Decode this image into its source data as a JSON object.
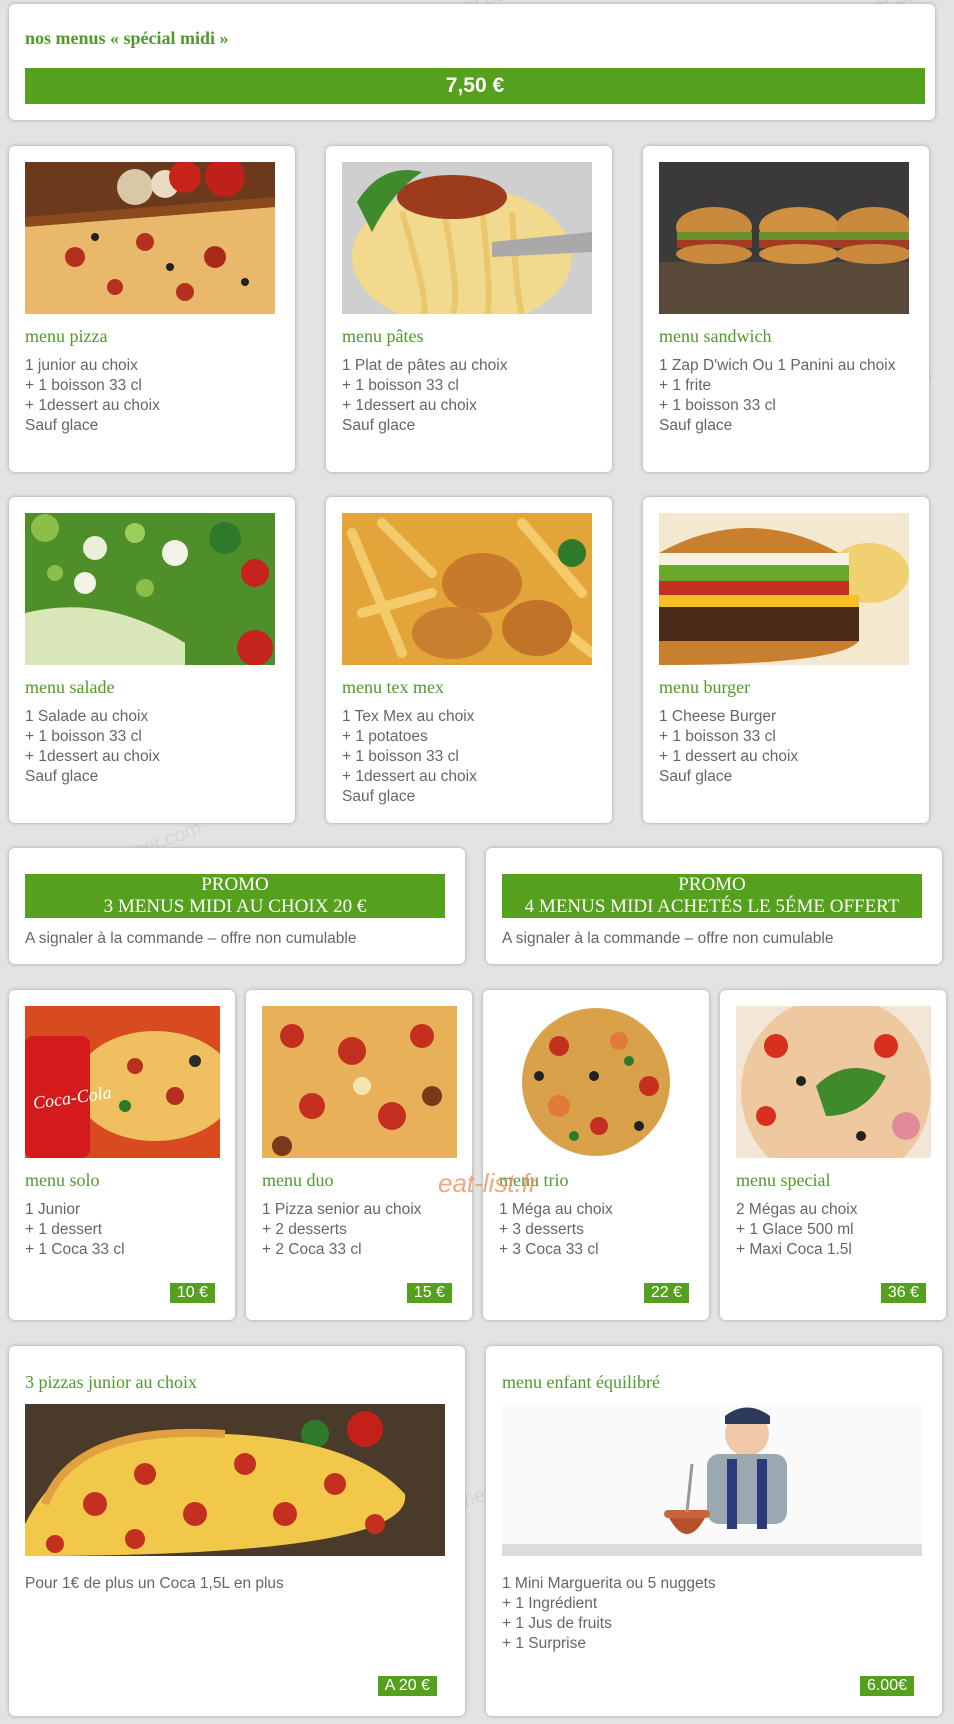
{
  "header": {
    "title": "nos menus « spécial midi »",
    "price": "7,50 €"
  },
  "menus_row1": [
    {
      "title": "menu pizza",
      "lines": [
        "1 junior au choix",
        "+ 1 boisson 33 cl",
        "+ 1dessert au choix",
        "Sauf glace"
      ],
      "image": "pizza-photo"
    },
    {
      "title": "menu pâtes",
      "lines": [
        "1 Plat de pâtes au choix",
        "+ 1 boisson 33 cl",
        "+ 1dessert au choix",
        "Sauf glace"
      ],
      "image": "pasta-photo"
    },
    {
      "title": "menu sandwich",
      "lines": [
        "1 Zap D'wich Ou 1 Panini au choix",
        "+ 1 frite",
        "+ 1 boisson 33 cl",
        "Sauf glace"
      ],
      "image": "sandwich-photo"
    }
  ],
  "menus_row2": [
    {
      "title": "menu salade",
      "lines": [
        "1 Salade au choix",
        "+ 1 boisson 33 cl",
        "+ 1dessert au choix",
        "Sauf glace"
      ],
      "image": "salad-photo"
    },
    {
      "title": "menu tex mex",
      "lines": [
        "1 Tex Mex au choix",
        "+ 1 potatoes",
        "+ 1 boisson 33 cl",
        "+ 1dessert au choix",
        "Sauf glace"
      ],
      "image": "texmex-photo"
    },
    {
      "title": "menu burger",
      "lines": [
        "1 Cheese Burger",
        "+ 1 boisson 33 cl",
        "+ 1 dessert au choix",
        "Sauf glace"
      ],
      "image": "burger-photo"
    }
  ],
  "promos": [
    {
      "label": "PROMO",
      "text": "3 MENUS MIDI AU CHOIX 20 €",
      "note": "A signaler à la commande – offre non cumulable"
    },
    {
      "label": "PROMO",
      "text": "4 MENUS MIDI ACHETÉS LE 5ÉME OFFERT",
      "note": "A signaler à la commande – offre non cumulable"
    }
  ],
  "menus_row3": [
    {
      "title": "menu solo",
      "lines": [
        "1 Junior",
        "+ 1 dessert",
        "+ 1 Coca 33 cl"
      ],
      "price": "10 €",
      "image": "pizza-coca-photo"
    },
    {
      "title": "menu duo",
      "lines": [
        "1 Pizza senior au choix",
        "+ 2 desserts",
        "+ 2 Coca 33 cl"
      ],
      "price": "15 €",
      "image": "pizza-photo"
    },
    {
      "title": "menu trio",
      "lines": [
        "1 Méga au choix",
        "+ 3 desserts",
        "+ 3 Coca 33 cl"
      ],
      "price": "22 €",
      "image": "pizza-photo"
    },
    {
      "title": "menu special",
      "lines": [
        "2 Mégas au choix",
        "+ 1 Glace 500 ml",
        "+ Maxi Coca 1.5l"
      ],
      "price": "36 €",
      "image": "pizza-basil-photo"
    }
  ],
  "bottom": [
    {
      "title": "3 pizzas junior au choix",
      "lines": [
        "Pour 1€ de plus un Coca 1,5L en plus"
      ],
      "price": "A 20 €",
      "image": "pepperoni-pizza-photo"
    },
    {
      "title": "menu enfant équilibré",
      "lines": [
        "1 Mini Marguerita ou 5 nuggets",
        "+ 1 Ingrédient",
        "+ 1 Jus de fruits",
        "+ 1 Surprise"
      ],
      "price": "6.00€",
      "image": "child-cooking-photo"
    }
  ],
  "overlay": {
    "eatlist": "eat-list.fr",
    "watermark": "www.ou-dejeuner.com"
  },
  "colors": {
    "accent": "#55a11e",
    "title_green": "#4f9a2a"
  }
}
